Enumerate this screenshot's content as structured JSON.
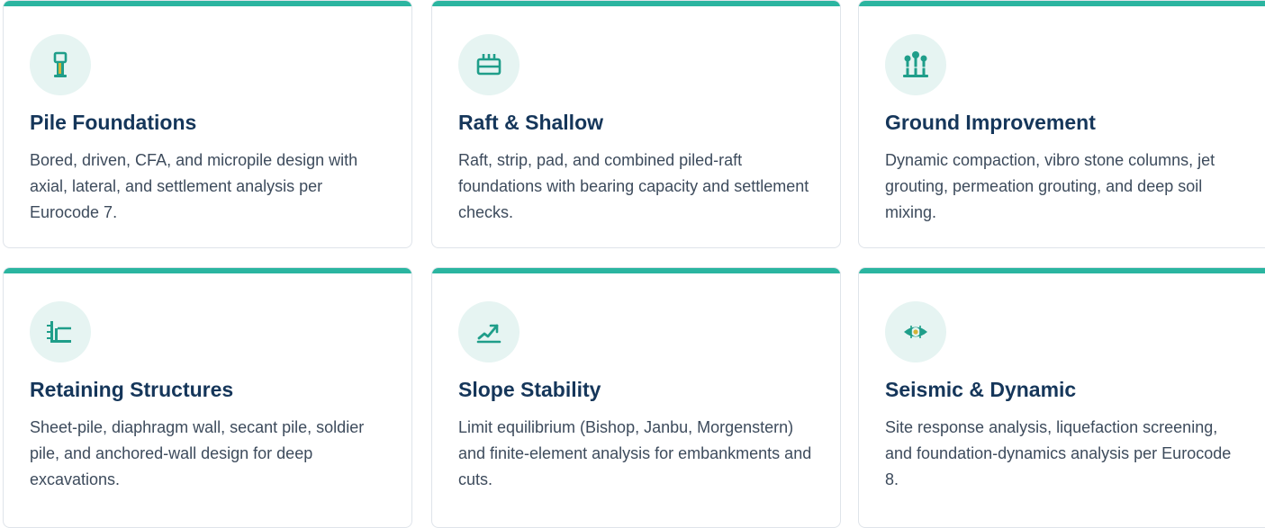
{
  "accent_color": "#2bb5a0",
  "cards": [
    {
      "icon": "pile-icon",
      "title": "Pile Foundations",
      "description": "Bored, driven, CFA, and micropile design with axial, lateral, and settlement analysis per Eurocode 7."
    },
    {
      "icon": "raft-icon",
      "title": "Raft & Shallow",
      "description": "Raft, strip, pad, and combined piled-raft foundations with bearing capacity and settlement checks."
    },
    {
      "icon": "stone-columns-icon",
      "title": "Ground Improvement",
      "description": "Dynamic compaction, vibro stone columns, jet grouting, permeation grouting, and deep soil mixing."
    },
    {
      "icon": "retaining-wall-icon",
      "title": "Retaining Structures",
      "description": "Sheet-pile, diaphragm wall, secant pile, soldier pile, and anchored-wall design for deep excavations."
    },
    {
      "icon": "slope-icon",
      "title": "Slope Stability",
      "description": "Limit equilibrium (Bishop, Janbu, Morgenstern) and finite-element analysis for embankments and cuts."
    },
    {
      "icon": "seismic-icon",
      "title": "Seismic & Dynamic",
      "description": "Site response analysis, liquefaction screening, and foundation-dynamics analysis per Eurocode 8."
    }
  ]
}
